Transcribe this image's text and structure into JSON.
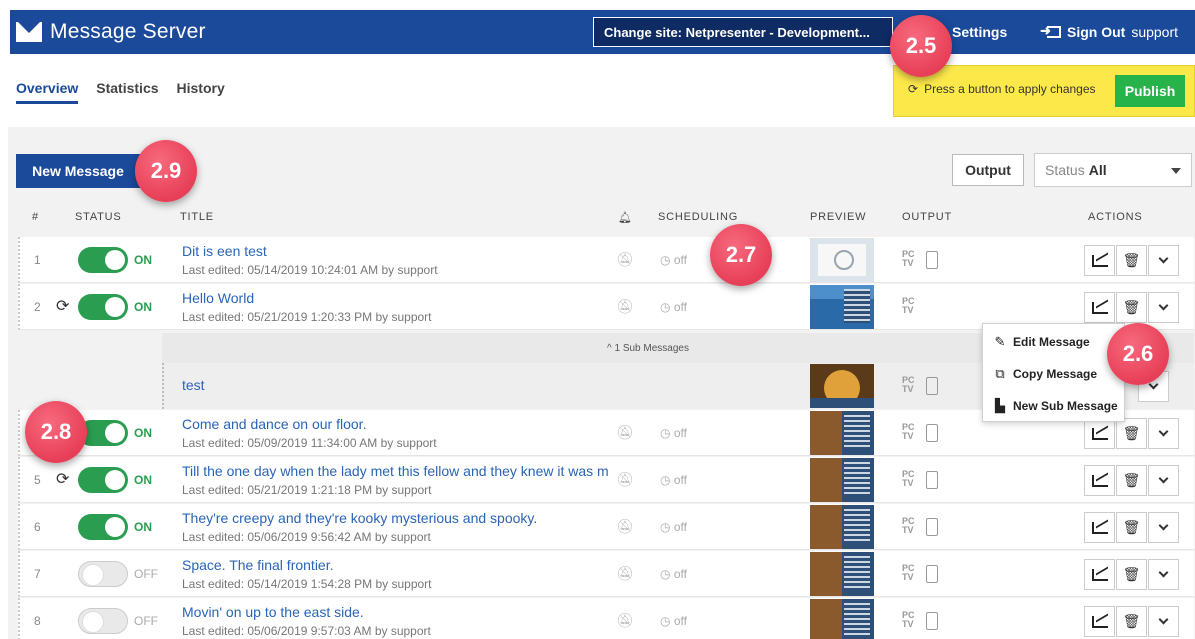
{
  "header": {
    "app_title": "Message Server",
    "site_select": "Change site: Netpresenter - Development...",
    "settings_label": "Settings",
    "signout_label": "Sign Out",
    "user": "support"
  },
  "tabs": [
    {
      "label": "Overview",
      "active": true
    },
    {
      "label": "Statistics",
      "active": false
    },
    {
      "label": "History",
      "active": false
    }
  ],
  "publish": {
    "message": "Press a button to apply changes",
    "button": "Publish"
  },
  "toolbar": {
    "new_message": "New Message",
    "output": "Output",
    "status_prefix": "Status",
    "status_value": "All"
  },
  "columns": {
    "num": "#",
    "status": "STATUS",
    "title": "TITLE",
    "scheduling": "SCHEDULING",
    "preview": "PREVIEW",
    "output": "OUTPUT",
    "actions": "ACTIONS"
  },
  "rows": [
    {
      "num": "1",
      "state": "ON",
      "title": "Dit is een test",
      "edited": "Last edited: 05/14/2019 10:24:01 AM by support",
      "sched": "off"
    },
    {
      "num": "2",
      "state": "ON",
      "title": "Hello World",
      "edited": "Last edited: 05/21/2019 1:20:33 PM by support",
      "sched": "off"
    },
    {
      "num": "",
      "state": "ON",
      "title": "Come and dance on our floor.",
      "edited": "Last edited: 05/09/2019 11:34:00 AM by support",
      "sched": "off"
    },
    {
      "num": "5",
      "state": "ON",
      "title": "Till the one day when the lady met this fellow and they knew it was m",
      "edited": "Last edited: 05/21/2019 1:21:18 PM by support",
      "sched": "off"
    },
    {
      "num": "6",
      "state": "ON",
      "title": "They're creepy and they're kooky mysterious and spooky.",
      "edited": "Last edited: 05/06/2019 9:56:42 AM by support",
      "sched": "off"
    },
    {
      "num": "7",
      "state": "OFF",
      "title": "Space. The final frontier.",
      "edited": "Last edited: 05/14/2019 1:54:28 PM by support",
      "sched": "off"
    },
    {
      "num": "8",
      "state": "OFF",
      "title": "Movin' on up to the east side.",
      "edited": "Last edited: 05/06/2019 9:57:03 AM by support",
      "sched": "off"
    }
  ],
  "output_labels": {
    "pc": "PC",
    "tv": "TV"
  },
  "sub_messages": {
    "label": "^ 1 Sub Messages",
    "title": "test"
  },
  "context_menu": [
    {
      "label": "Edit Message",
      "icon": "edit-icon"
    },
    {
      "label": "Copy Message",
      "icon": "copy-icon"
    },
    {
      "label": "New Sub Message",
      "icon": "file-icon"
    }
  ],
  "callouts": [
    "2.5",
    "2.9",
    "2.7",
    "2.6",
    "2.8"
  ]
}
